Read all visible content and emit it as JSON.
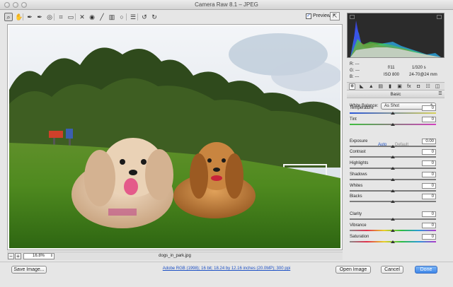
{
  "window": {
    "title": "Camera Raw 8.1  –  JPEG"
  },
  "toolbar": {
    "tools": [
      {
        "name": "zoom-tool",
        "icon": "magnifier-icon",
        "glyph": "⌕"
      },
      {
        "name": "hand-tool",
        "icon": "hand-icon",
        "glyph": "✋"
      },
      {
        "name": "white-balance-tool",
        "icon": "eyedropper-icon",
        "glyph": "✒"
      },
      {
        "name": "color-sampler-tool",
        "icon": "color-sampler-icon",
        "glyph": "✒"
      },
      {
        "name": "targeted-adjustment-tool",
        "icon": "target-icon",
        "glyph": "◎"
      },
      {
        "name": "crop-tool",
        "icon": "crop-icon",
        "glyph": "⌗"
      },
      {
        "name": "straighten-tool",
        "icon": "straighten-icon",
        "glyph": "▭"
      },
      {
        "name": "spot-removal-tool",
        "icon": "spot-removal-icon",
        "glyph": "✕"
      },
      {
        "name": "red-eye-tool",
        "icon": "eye-icon",
        "glyph": "◉"
      },
      {
        "name": "adjustment-brush-tool",
        "icon": "brush-icon",
        "glyph": "╱"
      },
      {
        "name": "graduated-filter-tool",
        "icon": "graduated-filter-icon",
        "glyph": "▥"
      },
      {
        "name": "radial-filter-tool",
        "icon": "radial-filter-icon",
        "glyph": "○"
      },
      {
        "name": "preferences-tool",
        "icon": "list-icon",
        "glyph": "☰"
      },
      {
        "name": "rotate-left-tool",
        "icon": "rotate-left-icon",
        "glyph": "↺"
      },
      {
        "name": "rotate-right-tool",
        "icon": "rotate-right-icon",
        "glyph": "↻"
      }
    ],
    "preview_label": "Preview",
    "preview_checked": true
  },
  "image": {
    "filename": "dogs_in_park.jpg",
    "zoom": "16.8%"
  },
  "readout": {
    "r_label": "R:",
    "g_label": "G:",
    "b_label": "B:",
    "r_value": "---",
    "g_value": "---",
    "b_value": "---",
    "aperture": "f/11",
    "shutter": "1/320 s",
    "iso": "ISO 800",
    "focal": "24-70@24 mm"
  },
  "panel": {
    "tabs": [
      {
        "name": "tab-basic",
        "icon": "aperture-icon",
        "glyph": "✵"
      },
      {
        "name": "tab-tone-curve",
        "icon": "curve-icon",
        "glyph": "◣"
      },
      {
        "name": "tab-detail",
        "icon": "triangle-icon",
        "glyph": "▲"
      },
      {
        "name": "tab-hsl",
        "icon": "hsl-icon",
        "glyph": "▤"
      },
      {
        "name": "tab-split-toning",
        "icon": "split-toning-icon",
        "glyph": "▮"
      },
      {
        "name": "tab-lens-corrections",
        "icon": "lens-icon",
        "glyph": "▣"
      },
      {
        "name": "tab-effects",
        "icon": "fx-icon",
        "glyph": "fx"
      },
      {
        "name": "tab-camera-calibration",
        "icon": "camera-icon",
        "glyph": "◘"
      },
      {
        "name": "tab-presets",
        "icon": "presets-icon",
        "glyph": "☷"
      },
      {
        "name": "tab-snapshots",
        "icon": "snapshots-icon",
        "glyph": "◫"
      }
    ],
    "section_title": "Basic",
    "white_balance_label": "White Balance:",
    "white_balance_value": "As Shot",
    "auto_label": "Auto",
    "default_label": "Default",
    "sliders": [
      {
        "label": "Temperature",
        "value": "0",
        "position": 0.5,
        "style": "temp"
      },
      {
        "label": "Tint",
        "value": "0",
        "position": 0.5,
        "style": "tint"
      },
      {
        "label": "Exposure",
        "value": "0.00",
        "position": 0.5,
        "style": "gray"
      },
      {
        "label": "Contrast",
        "value": "0",
        "position": 0.5,
        "style": "gray"
      },
      {
        "label": "Highlights",
        "value": "0",
        "position": 0.5,
        "style": "gray"
      },
      {
        "label": "Shadows",
        "value": "0",
        "position": 0.5,
        "style": "gray"
      },
      {
        "label": "Whites",
        "value": "0",
        "position": 0.5,
        "style": "gray"
      },
      {
        "label": "Blacks",
        "value": "0",
        "position": 0.5,
        "style": "gray"
      },
      {
        "label": "Clarity",
        "value": "0",
        "position": 0.5,
        "style": "gray"
      },
      {
        "label": "Vibrance",
        "value": "0",
        "position": 0.5,
        "style": "sat"
      },
      {
        "label": "Saturation",
        "value": "0",
        "position": 0.5,
        "style": "sat"
      }
    ]
  },
  "bottom": {
    "save_label": "Save Image...",
    "workflow_text": "Adobe RGB (1998); 16 bit; 18.24 by 12.16 inches (20.0MP); 300 ppi",
    "open_label": "Open Image",
    "cancel_label": "Cancel",
    "done_label": "Done"
  }
}
